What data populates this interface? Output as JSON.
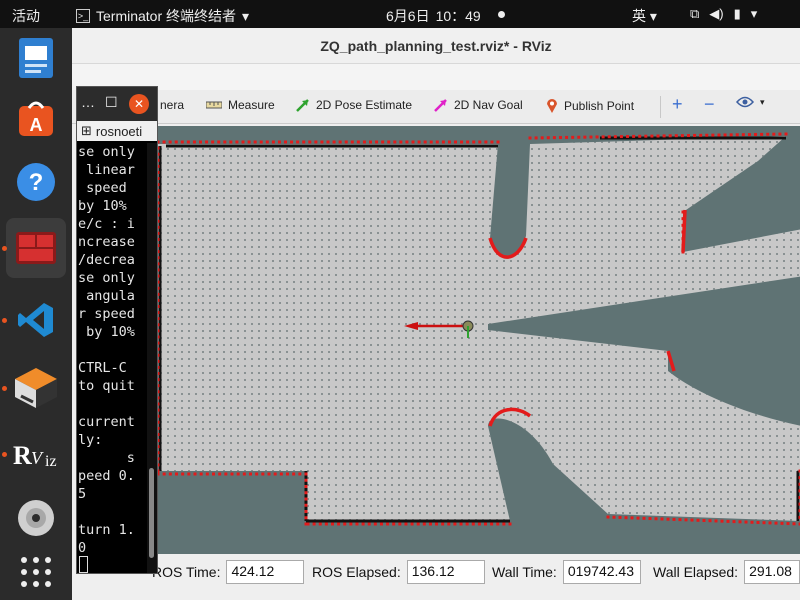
{
  "topbar": {
    "activities": "活动",
    "app_name": "Terminator 终端终结者",
    "date": "6月6日",
    "time": "10：49",
    "input_method": "英"
  },
  "dock": {
    "items": [
      "document-viewer",
      "app-store",
      "help",
      "terminator",
      "vscode",
      "sublime-merge",
      "rviz",
      "disk",
      "show-applications"
    ]
  },
  "rviz": {
    "title": "ZQ_path_planning_test.rviz* - RViz",
    "toolbar": {
      "camera_label": "nera",
      "measure_label": "Measure",
      "pose_label": "2D Pose Estimate",
      "nav_goal_label": "2D Nav Goal",
      "publish_point_label": "Publish Point"
    },
    "status": {
      "ros_time_label": "ROS Time:",
      "ros_time_value": "424.12",
      "ros_elapsed_label": "ROS Elapsed:",
      "ros_elapsed_value": "136.12",
      "wall_time_label": "Wall Time:",
      "wall_time_value": "019742.43",
      "wall_elapsed_label": "Wall Elapsed:",
      "wall_elapsed_value": "291.08"
    }
  },
  "terminal": {
    "tab_label": "rosnoeti",
    "lines": [
      "se only",
      " linear",
      " speed",
      "by 10%",
      "e/c : i",
      "ncrease",
      "/decrea",
      "se only",
      " angula",
      "r speed",
      " by 10%",
      "",
      "CTRL-C",
      "to quit",
      "",
      "current",
      "ly:",
      "      s",
      "peed 0.",
      "5",
      "",
      "turn 1.",
      "0"
    ]
  },
  "colors": {
    "map_unknown": "#5f7374",
    "map_free": "#c8c8c8",
    "obstacle": "#e31b1b",
    "accent": "#e95420"
  }
}
